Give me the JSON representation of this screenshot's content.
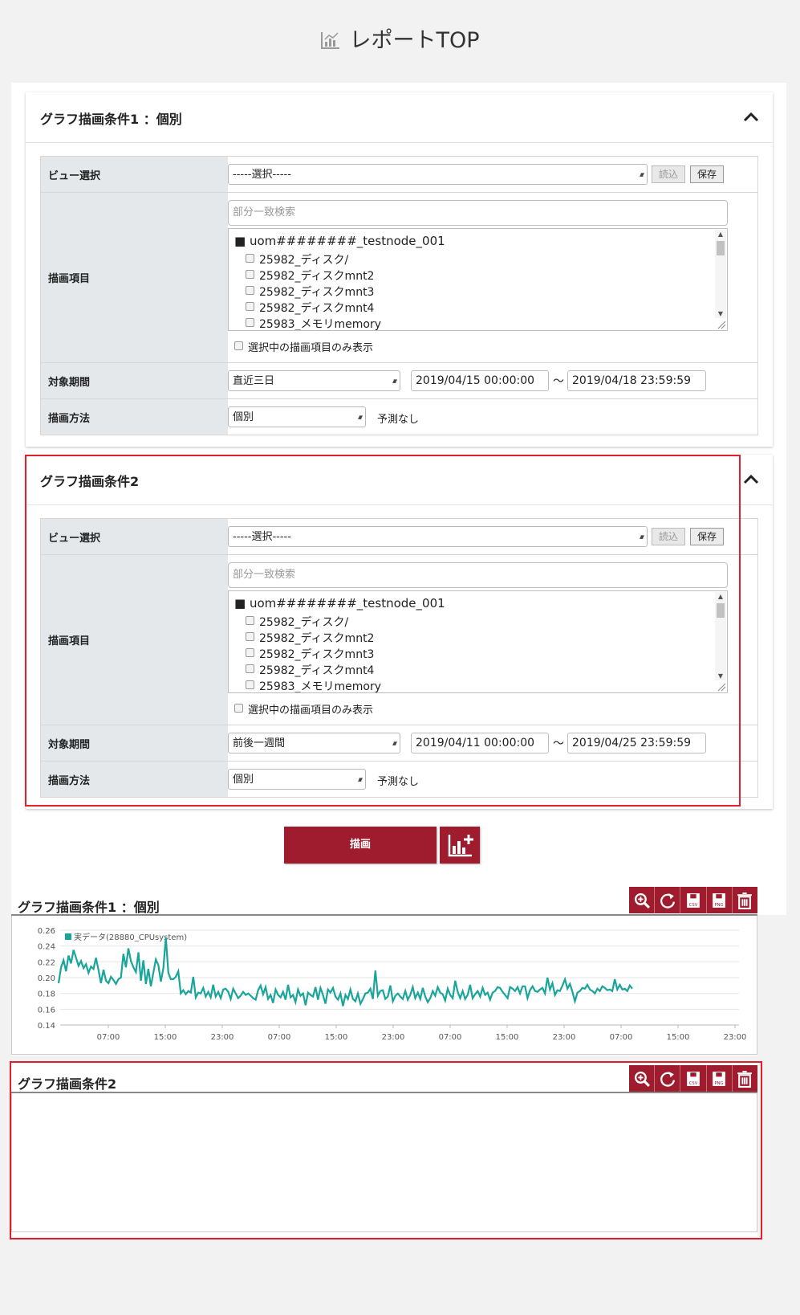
{
  "page": {
    "title": "レポートTOP"
  },
  "conditions": [
    {
      "title": "グラフ描画条件1 ：個別",
      "labels": {
        "view": "ビュー選択",
        "items": "描画項目",
        "period": "対象期間",
        "method": "描画方法"
      },
      "view_select": "-----選択-----",
      "load_label": "読込",
      "save_label": "保存",
      "search_placeholder": "部分一致検索",
      "node": "■ uom########_testnode_001",
      "items": [
        "25982_ディスク/",
        "25982_ディスクmnt2",
        "25982_ディスクmnt3",
        "25982_ディスクmnt4",
        "25983_メモリmemory"
      ],
      "show_selected_only": "選択中の描画項目のみ表示",
      "period_select": "直近三日",
      "date_from": "2019/04/15 00:00:00",
      "tilde": "～",
      "date_to": "2019/04/18 23:59:59",
      "method_select": "個別",
      "forecast": "予測なし"
    },
    {
      "title": "グラフ描画条件2",
      "labels": {
        "view": "ビュー選択",
        "items": "描画項目",
        "period": "対象期間",
        "method": "描画方法"
      },
      "view_select": "-----選択-----",
      "load_label": "読込",
      "save_label": "保存",
      "search_placeholder": "部分一致検索",
      "node": "■ uom########_testnode_001",
      "items": [
        "25982_ディスク/",
        "25982_ディスクmnt2",
        "25982_ディスクmnt3",
        "25982_ディスクmnt4",
        "25983_メモリmemory"
      ],
      "show_selected_only": "選択中の描画項目のみ表示",
      "period_select": "前後一週間",
      "date_from": "2019/04/11 00:00:00",
      "tilde": "～",
      "date_to": "2019/04/25 23:59:59",
      "method_select": "個別",
      "forecast": "予測なし"
    }
  ],
  "draw_button": "描画",
  "graphs": [
    {
      "title": "グラフ描画条件1 ：個別"
    },
    {
      "title": "グラフ描画条件2"
    }
  ],
  "toolbar_icons": [
    "zoom-icon",
    "refresh-icon",
    "csv-download-icon",
    "png-download-icon",
    "trash-icon"
  ],
  "colors": {
    "accent": "#9e1c2e",
    "highlight": "#e0202c",
    "series": "#1aa59a"
  },
  "chart_data": {
    "type": "line",
    "title": "",
    "legend": "実データ(28880_CPUsystem)",
    "legend_position": "top-left",
    "ylim": [
      0.14,
      0.26
    ],
    "yticks": [
      "0.26",
      "0.24",
      "0.22",
      "0.20",
      "0.18",
      "0.16",
      "0.14"
    ],
    "xticks": [
      "07:00",
      "15:00",
      "23:00",
      "07:00",
      "15:00",
      "23:00",
      "07:00",
      "15:00",
      "23:00",
      "07:00",
      "15:00",
      "23:00"
    ],
    "grid": true,
    "series": [
      {
        "color": "#1aa59a",
        "values": [
          0.193,
          0.213,
          0.222,
          0.208,
          0.228,
          0.218,
          0.235,
          0.225,
          0.215,
          0.221,
          0.212,
          0.217,
          0.206,
          0.214,
          0.211,
          0.225,
          0.21,
          0.193,
          0.21,
          0.196,
          0.193,
          0.201,
          0.197,
          0.192,
          0.198,
          0.2,
          0.23,
          0.213,
          0.237,
          0.221,
          0.213,
          0.207,
          0.232,
          0.196,
          0.222,
          0.192,
          0.211,
          0.189,
          0.206,
          0.223,
          0.216,
          0.195,
          0.212,
          0.251,
          0.206,
          0.198,
          0.198,
          0.201,
          0.208,
          0.18,
          0.184,
          0.179,
          0.183,
          0.181,
          0.201,
          0.175,
          0.181,
          0.18,
          0.187,
          0.176,
          0.182,
          0.175,
          0.191,
          0.176,
          0.182,
          0.174,
          0.185,
          0.186,
          0.182,
          0.173,
          0.186,
          0.18,
          0.174,
          0.177,
          0.182,
          0.178,
          0.18,
          0.177,
          0.174,
          0.172,
          0.184,
          0.19,
          0.179,
          0.188,
          0.173,
          0.178,
          0.168,
          0.185,
          0.178,
          0.175,
          0.182,
          0.172,
          0.191,
          0.175,
          0.178,
          0.169,
          0.185,
          0.177,
          0.18,
          0.165,
          0.181,
          0.178,
          0.176,
          0.188,
          0.172,
          0.187,
          0.178,
          0.167,
          0.185,
          0.181,
          0.187,
          0.176,
          0.172,
          0.18,
          0.164,
          0.178,
          0.173,
          0.185,
          0.173,
          0.17,
          0.18,
          0.167,
          0.173,
          0.18,
          0.181,
          0.186,
          0.173,
          0.209,
          0.177,
          0.183,
          0.184,
          0.173,
          0.176,
          0.19,
          0.17,
          0.177,
          0.18,
          0.176,
          0.173,
          0.183,
          0.172,
          0.178,
          0.188,
          0.174,
          0.181,
          0.173,
          0.187,
          0.176,
          0.169,
          0.174,
          0.183,
          0.177,
          0.188,
          0.181,
          0.179,
          0.171,
          0.186,
          0.178,
          0.174,
          0.196,
          0.182,
          0.174,
          0.183,
          0.173,
          0.178,
          0.191,
          0.174,
          0.179,
          0.183,
          0.176,
          0.187,
          0.178,
          0.181,
          0.172,
          0.181,
          0.183,
          0.188,
          0.187,
          0.182,
          0.178,
          0.174,
          0.188,
          0.186,
          0.183,
          0.188,
          0.18,
          0.189,
          0.189,
          0.174,
          0.184,
          0.189,
          0.183,
          0.182,
          0.185,
          0.187,
          0.18,
          0.2,
          0.185,
          0.193,
          0.178,
          0.184,
          0.183,
          0.19,
          0.198,
          0.186,
          0.192,
          0.182,
          0.17,
          0.181,
          0.183,
          0.187,
          0.186,
          0.191,
          0.185,
          0.183,
          0.18,
          0.186,
          0.183,
          0.189,
          0.187,
          0.184,
          0.185,
          0.183,
          0.198,
          0.185,
          0.191,
          0.185,
          0.186,
          0.183,
          0.19,
          0.186
        ]
      }
    ]
  }
}
